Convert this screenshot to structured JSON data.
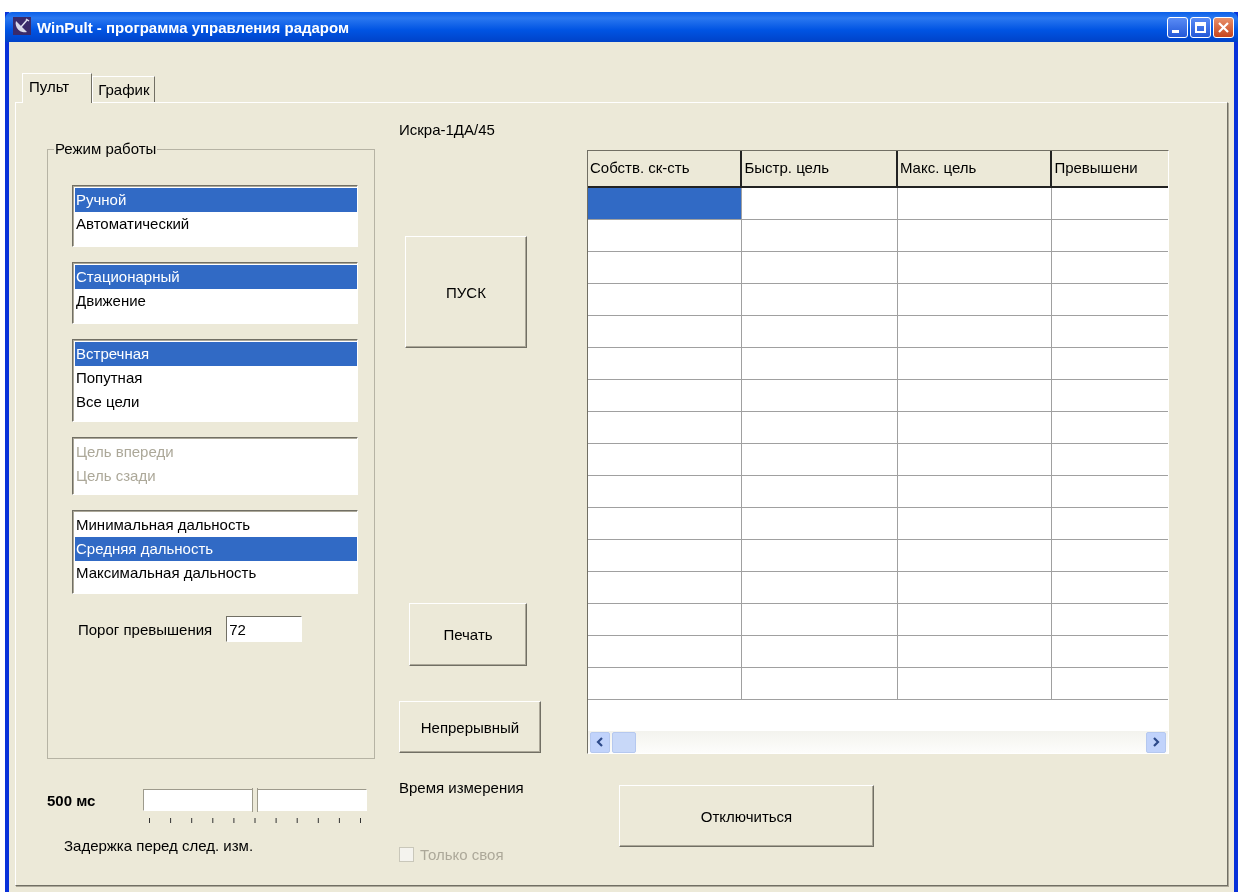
{
  "window": {
    "title": "WinPult - программа управления радаром"
  },
  "tabs": [
    {
      "label": "Пульт",
      "selected": true
    },
    {
      "label": "График",
      "selected": false
    }
  ],
  "device_label": "Искра-1ДА/45",
  "mode_group": {
    "title": "Режим работы",
    "lists": [
      {
        "disabled": false,
        "items": [
          {
            "label": "Ручной",
            "selected": true
          },
          {
            "label": "Автоматический",
            "selected": false
          }
        ]
      },
      {
        "disabled": false,
        "items": [
          {
            "label": "Стационарный",
            "selected": true
          },
          {
            "label": "Движение",
            "selected": false
          }
        ]
      },
      {
        "disabled": false,
        "items": [
          {
            "label": "Встречная",
            "selected": true
          },
          {
            "label": "Попутная",
            "selected": false
          },
          {
            "label": "Все цели",
            "selected": false
          }
        ]
      },
      {
        "disabled": true,
        "items": [
          {
            "label": "Цель впереди",
            "selected": false
          },
          {
            "label": "Цель сзади",
            "selected": false
          }
        ]
      },
      {
        "disabled": false,
        "items": [
          {
            "label": "Минимальная дальность",
            "selected": false
          },
          {
            "label": "Средняя дальность",
            "selected": true
          },
          {
            "label": "Максимальная дальность",
            "selected": false
          }
        ]
      }
    ],
    "threshold": {
      "label": "Порог превышения",
      "value": "72"
    }
  },
  "start_button": "ПУСК",
  "print_button": "Печать",
  "continuous_button": "Непрерывный",
  "table": {
    "columns": [
      "Собств. ск-сть",
      "Быстр. цель",
      "Макс. цель",
      "Превышени"
    ],
    "rows": [
      {
        "cells": [
          {
            "selected": true
          },
          {
            "selected": false
          },
          {
            "selected": false
          },
          {
            "selected": false
          }
        ]
      },
      {
        "cells": [
          {
            "selected": false
          },
          {
            "selected": false
          },
          {
            "selected": false
          },
          {
            "selected": false
          }
        ]
      },
      {
        "cells": [
          {
            "selected": false
          },
          {
            "selected": false
          },
          {
            "selected": false
          },
          {
            "selected": false
          }
        ]
      },
      {
        "cells": [
          {
            "selected": false
          },
          {
            "selected": false
          },
          {
            "selected": false
          },
          {
            "selected": false
          }
        ]
      },
      {
        "cells": [
          {
            "selected": false
          },
          {
            "selected": false
          },
          {
            "selected": false
          },
          {
            "selected": false
          }
        ]
      },
      {
        "cells": [
          {
            "selected": false
          },
          {
            "selected": false
          },
          {
            "selected": false
          },
          {
            "selected": false
          }
        ]
      },
      {
        "cells": [
          {
            "selected": false
          },
          {
            "selected": false
          },
          {
            "selected": false
          },
          {
            "selected": false
          }
        ]
      },
      {
        "cells": [
          {
            "selected": false
          },
          {
            "selected": false
          },
          {
            "selected": false
          },
          {
            "selected": false
          }
        ]
      },
      {
        "cells": [
          {
            "selected": false
          },
          {
            "selected": false
          },
          {
            "selected": false
          },
          {
            "selected": false
          }
        ]
      },
      {
        "cells": [
          {
            "selected": false
          },
          {
            "selected": false
          },
          {
            "selected": false
          },
          {
            "selected": false
          }
        ]
      },
      {
        "cells": [
          {
            "selected": false
          },
          {
            "selected": false
          },
          {
            "selected": false
          },
          {
            "selected": false
          }
        ]
      },
      {
        "cells": [
          {
            "selected": false
          },
          {
            "selected": false
          },
          {
            "selected": false
          },
          {
            "selected": false
          }
        ]
      },
      {
        "cells": [
          {
            "selected": false
          },
          {
            "selected": false
          },
          {
            "selected": false
          },
          {
            "selected": false
          }
        ]
      },
      {
        "cells": [
          {
            "selected": false
          },
          {
            "selected": false
          },
          {
            "selected": false
          },
          {
            "selected": false
          }
        ]
      },
      {
        "cells": [
          {
            "selected": false
          },
          {
            "selected": false
          },
          {
            "selected": false
          },
          {
            "selected": false
          }
        ]
      },
      {
        "cells": [
          {
            "selected": false
          },
          {
            "selected": false
          },
          {
            "selected": false
          },
          {
            "selected": false
          }
        ]
      }
    ]
  },
  "delay": {
    "value_label": "500 мс",
    "level": 0.5,
    "caption": "Задержка перед след. изм."
  },
  "measure_time_label": "Время измерения",
  "only_own": {
    "label": "Только своя",
    "checked": false,
    "disabled": true
  },
  "disconnect_button": "Отключиться"
}
